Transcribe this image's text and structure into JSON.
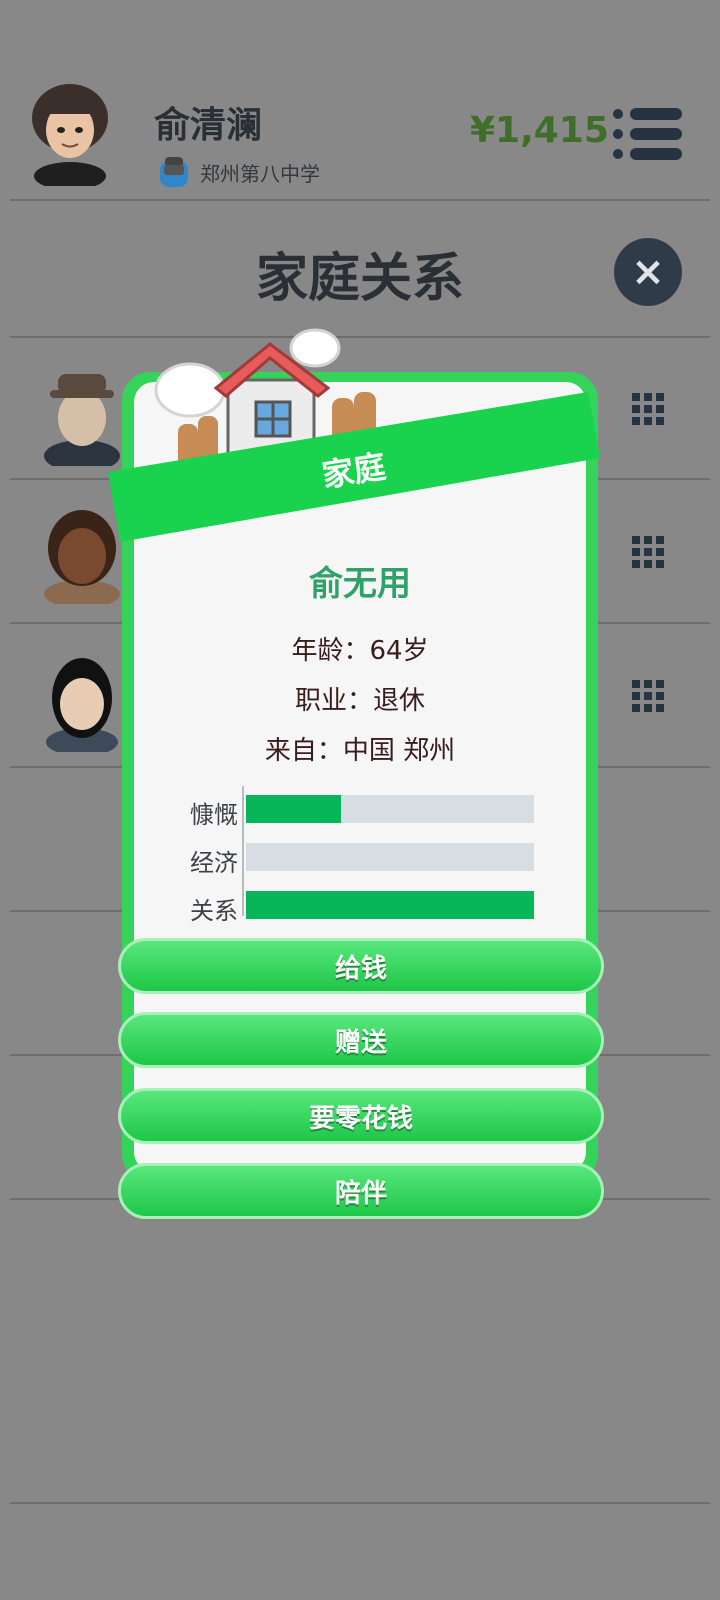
{
  "header": {
    "player_name": "俞清澜",
    "school": "郑州第八中学",
    "money": "¥1,415"
  },
  "panel": {
    "title": "家庭关系"
  },
  "modal": {
    "ribbon_label": "家庭",
    "person_name": "俞无用",
    "age_line": "年龄：64岁",
    "job_line": "职业：退休",
    "from_line": "来自：中国 郑州",
    "stats": [
      {
        "label": "慷慨",
        "value": 0.33
      },
      {
        "label": "经济",
        "value": 0.0
      },
      {
        "label": "关系",
        "value": 1.0
      }
    ],
    "buttons": [
      "给钱",
      "赠送",
      "要零花钱",
      "陪伴"
    ]
  },
  "colors": {
    "accent_green": "#35d35a",
    "money_green": "#3f6d2a",
    "bar_fill": "#08b65a",
    "bar_track": "#d8dde3"
  },
  "icons": [
    "avatar-player-icon",
    "school-bag-icon",
    "menu-icon",
    "close-icon",
    "grid-icon",
    "house-icon",
    "cloud-icon"
  ]
}
